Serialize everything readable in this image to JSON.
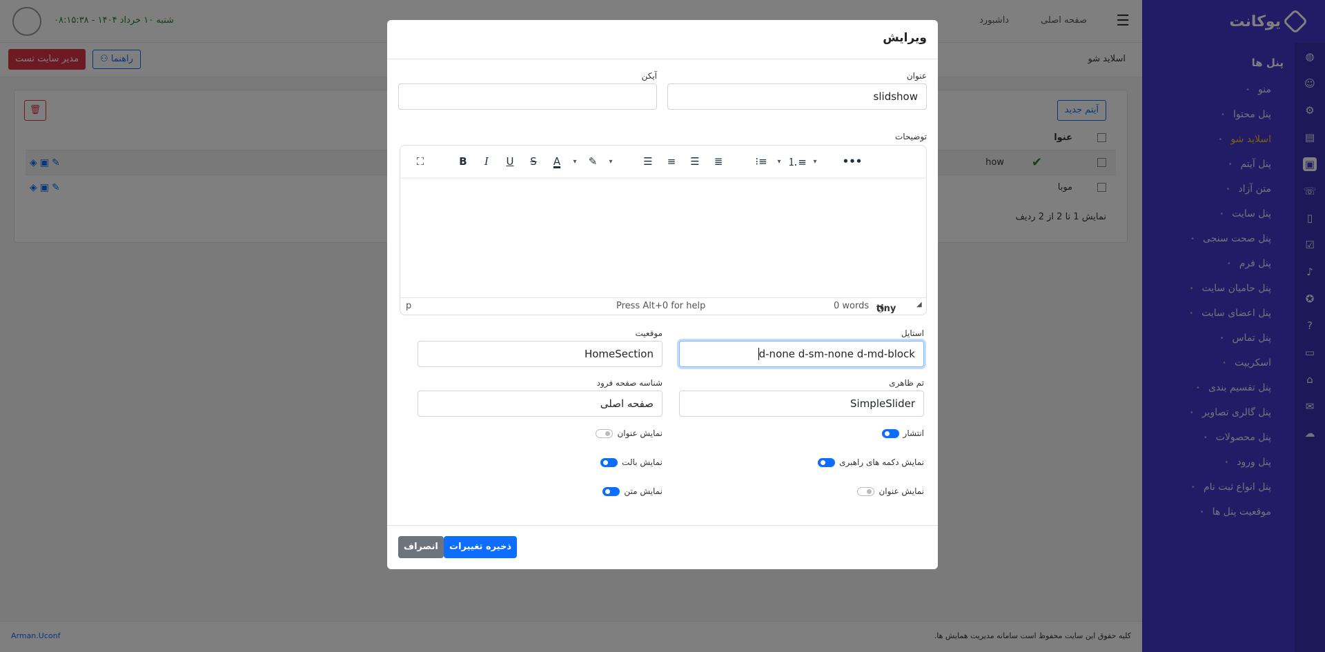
{
  "sidebar": {
    "brand": "یوکانت",
    "section": "پنل ها",
    "items": [
      "منو",
      "پنل محتوا",
      "اسلاید شو",
      "پنل آیتم",
      "متن آزاد",
      "پنل سایت",
      "پنل صحت سنجی",
      "پنل فرم",
      "پنل حامیان سایت",
      "پنل اعضای سایت",
      "پنل تماس",
      "اسکریپت",
      "پنل تقسیم بندی",
      "پنل گالری تصاویر",
      "پنل محصولات",
      "پنل ورود",
      "پنل انواع ثبت نام",
      "موقعیت پنل ها"
    ]
  },
  "topbar": {
    "nav_home": "صفحه اصلی",
    "nav_dashboard": "داشبورد",
    "datetime": "شنبه ۱۰ خرداد ۱۴۰۴ - ۰۸:۱۵:۳۸"
  },
  "subbar": {
    "breadcrumb": "اسلاید شو",
    "guide": "راهنما",
    "admin": "مدیر سایت تست"
  },
  "list": {
    "new_item": "آیتم جدید",
    "header_title": "عنوا",
    "rows": [
      "how",
      "موبا"
    ],
    "pager": "نمایش 1 تا 2 از 2 ردیف"
  },
  "footer": {
    "copyright": "کلیه حقوق این سایت محفوظ است سامانه مدیریت همایش ها.",
    "author": "Arman.Uconf"
  },
  "modal": {
    "title": "ویرایش",
    "labels": {
      "title": "عنوان",
      "icon": "آیکن",
      "description": "توضیحات",
      "style": "استایل",
      "position": "موقعیت",
      "theme": "تم ظاهری",
      "landing": "شناسه صفحه فرود"
    },
    "values": {
      "title": "slidshow",
      "icon": "",
      "style_before": "d-none  d-sm-none d-md-block",
      "position": "HomeSection",
      "theme": "SimpleSlider",
      "landing": "صفحه اصلی"
    },
    "editor": {
      "path": "p",
      "help": "Press Alt+0 for help",
      "words": "0 words",
      "brand": "tiny"
    },
    "toggles": {
      "publish": {
        "label": "انتشار",
        "on": true
      },
      "show_title_right": {
        "label": "نمایش عنوان",
        "on": false
      },
      "show_guide_buttons": {
        "label": "نمایش دکمه های راهبری",
        "on": true
      },
      "show_bullet": {
        "label": "نمایش بالت",
        "on": true
      },
      "show_title_left": {
        "label": "نمایش عنوان",
        "on": false
      },
      "show_text": {
        "label": "نمایش متن",
        "on": true
      }
    },
    "save": "ذخیره تغییرات",
    "cancel": "انصراف"
  },
  "colors": {
    "primary": "#0d6efd",
    "sidebar": "#4338ca",
    "danger": "#dc3545",
    "secondary": "#6c757d"
  }
}
